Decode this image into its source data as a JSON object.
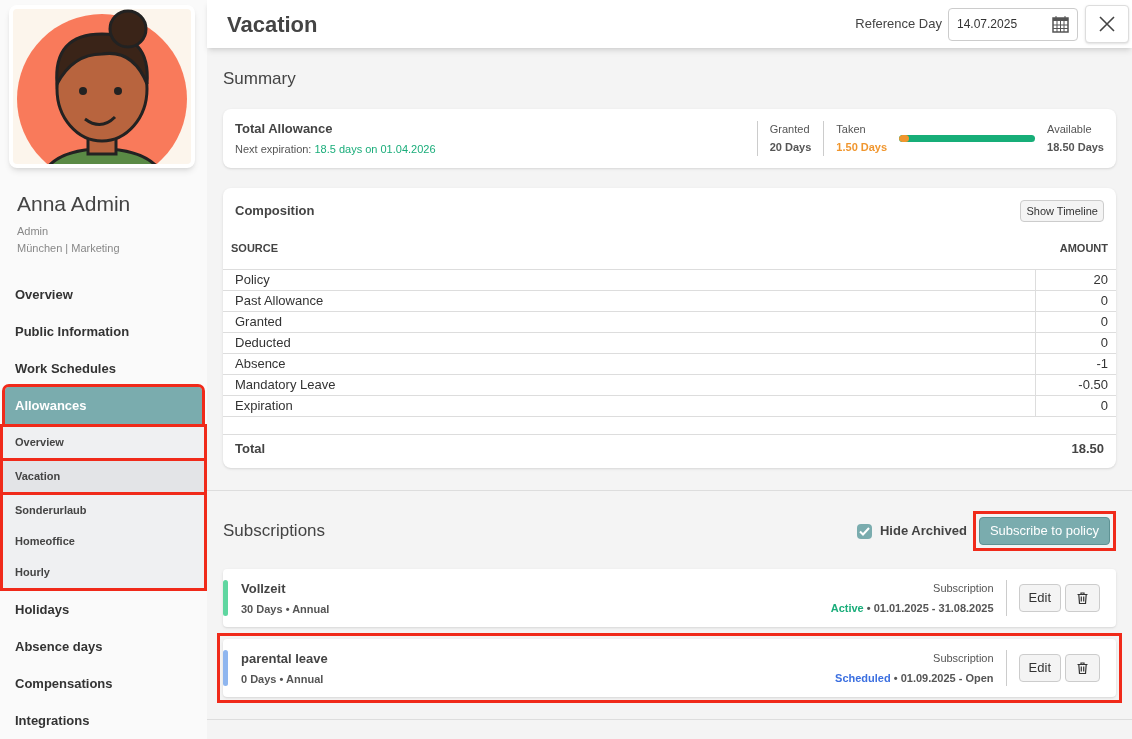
{
  "profile": {
    "name": "Anna Admin",
    "role": "Admin",
    "location": "München | Marketing"
  },
  "sidebar": {
    "items": [
      {
        "label": "Overview",
        "selected": false,
        "highlighted": false
      },
      {
        "label": "Public Information",
        "selected": false,
        "highlighted": false
      },
      {
        "label": "Work Schedules",
        "selected": false,
        "highlighted": false
      },
      {
        "label": "Allowances",
        "selected": true,
        "highlighted": true,
        "children": [
          {
            "highlighted": true,
            "items": [
              {
                "label": "Overview",
                "selected": false
              }
            ]
          },
          {
            "highlighted": true,
            "items": [
              {
                "label": "Vacation",
                "selected": true
              }
            ]
          },
          {
            "highlighted": true,
            "items": [
              {
                "label": "Sonderurlaub",
                "selected": false
              },
              {
                "label": "Homeoffice",
                "selected": false
              },
              {
                "label": "Hourly",
                "selected": false
              }
            ]
          }
        ]
      },
      {
        "label": "Holidays",
        "selected": false,
        "highlighted": false
      },
      {
        "label": "Absence days",
        "selected": false,
        "highlighted": false
      },
      {
        "label": "Compensations",
        "selected": false,
        "highlighted": false
      },
      {
        "label": "Integrations",
        "selected": false,
        "highlighted": false
      }
    ]
  },
  "header": {
    "title": "Vacation",
    "reference_label": "Reference Day",
    "reference_value": "14.07.2025"
  },
  "summary": {
    "heading": "Summary",
    "title": "Total Allowance",
    "expiration_label": "Next expiration:",
    "expiration_value": "18.5 days on 01.04.2026",
    "granted_label": "Granted",
    "granted_value": "20 Days",
    "taken_label": "Taken",
    "taken_value": "1.50 Days",
    "level": 0.075,
    "available_label": "Available",
    "available_value": "18.50 Days"
  },
  "composition": {
    "title": "Composition",
    "timeline_button": "Show Timeline",
    "columns": [
      "SOURCE",
      "AMOUNT"
    ],
    "rows": [
      [
        "Policy",
        "20"
      ],
      [
        "Past Allowance",
        "0"
      ],
      [
        "Granted",
        "0"
      ],
      [
        "Deducted",
        "0"
      ],
      [
        "Absence",
        "-1"
      ],
      [
        "Mandatory Leave",
        "-0.50"
      ],
      [
        "Expiration",
        "0"
      ]
    ],
    "total": [
      "Total",
      "18.50"
    ]
  },
  "subscriptions": {
    "heading": "Subscriptions",
    "hide_archived": {
      "label": "Hide Archived",
      "checked": true
    },
    "subscribe_button": {
      "label": "Subscribe to policy",
      "highlighted": true
    },
    "items": [
      {
        "name": "Vollzeit",
        "details": "30 Days • Annual",
        "type_label": "Subscription",
        "status": "Active",
        "kind": "active",
        "period": " • 01.01.2025 - 31.08.2025",
        "color": "#5fd6a0",
        "edit": "Edit",
        "highlighted": false
      },
      {
        "name": "parental leave",
        "details": "0 Days • Annual",
        "type_label": "Subscription",
        "status": "Scheduled",
        "kind": "scheduled",
        "period": " • 01.09.2025 - Open",
        "color": "#8fb6ef",
        "edit": "Edit",
        "highlighted": true
      }
    ]
  }
}
